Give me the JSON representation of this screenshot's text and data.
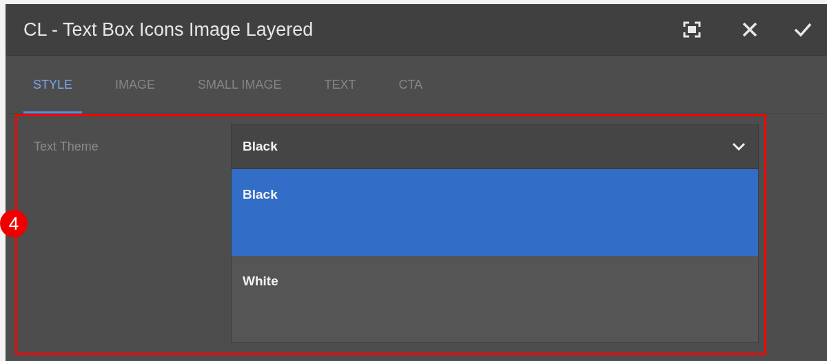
{
  "dialog": {
    "title": "CL - Text Box Icons Image Layered"
  },
  "tabs": [
    {
      "label": "STYLE",
      "selected": true
    },
    {
      "label": "IMAGE",
      "selected": false
    },
    {
      "label": "SMALL IMAGE",
      "selected": false
    },
    {
      "label": "TEXT",
      "selected": false
    },
    {
      "label": "CTA",
      "selected": false
    }
  ],
  "field": {
    "label": "Text Theme",
    "value": "Black",
    "expanded": true,
    "options": [
      {
        "label": "Black",
        "selected": true
      },
      {
        "label": "White",
        "selected": false
      }
    ]
  },
  "annotation": {
    "number": "4"
  }
}
